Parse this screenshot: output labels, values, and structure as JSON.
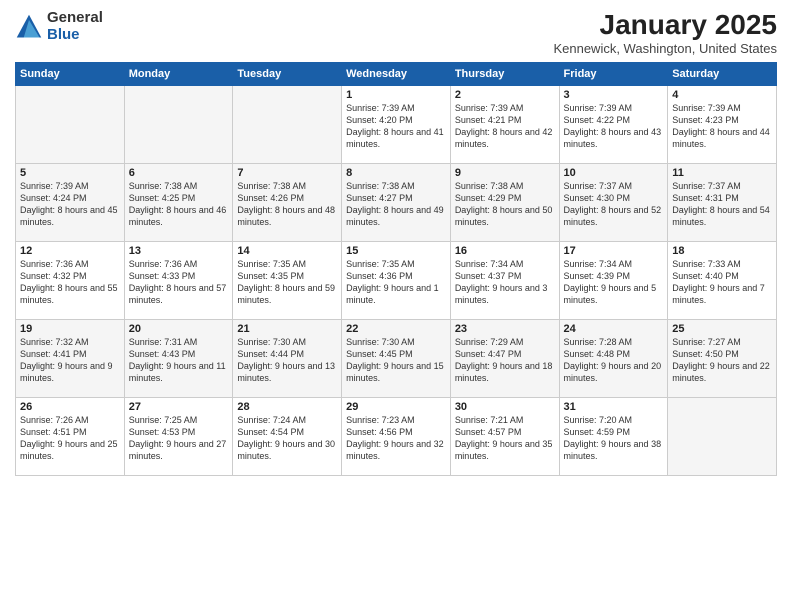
{
  "logo": {
    "general": "General",
    "blue": "Blue"
  },
  "title": "January 2025",
  "subtitle": "Kennewick, Washington, United States",
  "days_of_week": [
    "Sunday",
    "Monday",
    "Tuesday",
    "Wednesday",
    "Thursday",
    "Friday",
    "Saturday"
  ],
  "weeks": [
    [
      {
        "day": "",
        "info": "",
        "empty": true
      },
      {
        "day": "",
        "info": "",
        "empty": true
      },
      {
        "day": "",
        "info": "",
        "empty": true
      },
      {
        "day": "1",
        "info": "Sunrise: 7:39 AM\nSunset: 4:20 PM\nDaylight: 8 hours and 41 minutes.",
        "shade": false
      },
      {
        "day": "2",
        "info": "Sunrise: 7:39 AM\nSunset: 4:21 PM\nDaylight: 8 hours and 42 minutes.",
        "shade": false
      },
      {
        "day": "3",
        "info": "Sunrise: 7:39 AM\nSunset: 4:22 PM\nDaylight: 8 hours and 43 minutes.",
        "shade": false
      },
      {
        "day": "4",
        "info": "Sunrise: 7:39 AM\nSunset: 4:23 PM\nDaylight: 8 hours and 44 minutes.",
        "shade": false
      }
    ],
    [
      {
        "day": "5",
        "info": "Sunrise: 7:39 AM\nSunset: 4:24 PM\nDaylight: 8 hours and 45 minutes.",
        "shade": true
      },
      {
        "day": "6",
        "info": "Sunrise: 7:38 AM\nSunset: 4:25 PM\nDaylight: 8 hours and 46 minutes.",
        "shade": true
      },
      {
        "day": "7",
        "info": "Sunrise: 7:38 AM\nSunset: 4:26 PM\nDaylight: 8 hours and 48 minutes.",
        "shade": true
      },
      {
        "day": "8",
        "info": "Sunrise: 7:38 AM\nSunset: 4:27 PM\nDaylight: 8 hours and 49 minutes.",
        "shade": true
      },
      {
        "day": "9",
        "info": "Sunrise: 7:38 AM\nSunset: 4:29 PM\nDaylight: 8 hours and 50 minutes.",
        "shade": true
      },
      {
        "day": "10",
        "info": "Sunrise: 7:37 AM\nSunset: 4:30 PM\nDaylight: 8 hours and 52 minutes.",
        "shade": true
      },
      {
        "day": "11",
        "info": "Sunrise: 7:37 AM\nSunset: 4:31 PM\nDaylight: 8 hours and 54 minutes.",
        "shade": true
      }
    ],
    [
      {
        "day": "12",
        "info": "Sunrise: 7:36 AM\nSunset: 4:32 PM\nDaylight: 8 hours and 55 minutes.",
        "shade": false
      },
      {
        "day": "13",
        "info": "Sunrise: 7:36 AM\nSunset: 4:33 PM\nDaylight: 8 hours and 57 minutes.",
        "shade": false
      },
      {
        "day": "14",
        "info": "Sunrise: 7:35 AM\nSunset: 4:35 PM\nDaylight: 8 hours and 59 minutes.",
        "shade": false
      },
      {
        "day": "15",
        "info": "Sunrise: 7:35 AM\nSunset: 4:36 PM\nDaylight: 9 hours and 1 minute.",
        "shade": false
      },
      {
        "day": "16",
        "info": "Sunrise: 7:34 AM\nSunset: 4:37 PM\nDaylight: 9 hours and 3 minutes.",
        "shade": false
      },
      {
        "day": "17",
        "info": "Sunrise: 7:34 AM\nSunset: 4:39 PM\nDaylight: 9 hours and 5 minutes.",
        "shade": false
      },
      {
        "day": "18",
        "info": "Sunrise: 7:33 AM\nSunset: 4:40 PM\nDaylight: 9 hours and 7 minutes.",
        "shade": false
      }
    ],
    [
      {
        "day": "19",
        "info": "Sunrise: 7:32 AM\nSunset: 4:41 PM\nDaylight: 9 hours and 9 minutes.",
        "shade": true
      },
      {
        "day": "20",
        "info": "Sunrise: 7:31 AM\nSunset: 4:43 PM\nDaylight: 9 hours and 11 minutes.",
        "shade": true
      },
      {
        "day": "21",
        "info": "Sunrise: 7:30 AM\nSunset: 4:44 PM\nDaylight: 9 hours and 13 minutes.",
        "shade": true
      },
      {
        "day": "22",
        "info": "Sunrise: 7:30 AM\nSunset: 4:45 PM\nDaylight: 9 hours and 15 minutes.",
        "shade": true
      },
      {
        "day": "23",
        "info": "Sunrise: 7:29 AM\nSunset: 4:47 PM\nDaylight: 9 hours and 18 minutes.",
        "shade": true
      },
      {
        "day": "24",
        "info": "Sunrise: 7:28 AM\nSunset: 4:48 PM\nDaylight: 9 hours and 20 minutes.",
        "shade": true
      },
      {
        "day": "25",
        "info": "Sunrise: 7:27 AM\nSunset: 4:50 PM\nDaylight: 9 hours and 22 minutes.",
        "shade": true
      }
    ],
    [
      {
        "day": "26",
        "info": "Sunrise: 7:26 AM\nSunset: 4:51 PM\nDaylight: 9 hours and 25 minutes.",
        "shade": false
      },
      {
        "day": "27",
        "info": "Sunrise: 7:25 AM\nSunset: 4:53 PM\nDaylight: 9 hours and 27 minutes.",
        "shade": false
      },
      {
        "day": "28",
        "info": "Sunrise: 7:24 AM\nSunset: 4:54 PM\nDaylight: 9 hours and 30 minutes.",
        "shade": false
      },
      {
        "day": "29",
        "info": "Sunrise: 7:23 AM\nSunset: 4:56 PM\nDaylight: 9 hours and 32 minutes.",
        "shade": false
      },
      {
        "day": "30",
        "info": "Sunrise: 7:21 AM\nSunset: 4:57 PM\nDaylight: 9 hours and 35 minutes.",
        "shade": false
      },
      {
        "day": "31",
        "info": "Sunrise: 7:20 AM\nSunset: 4:59 PM\nDaylight: 9 hours and 38 minutes.",
        "shade": false
      },
      {
        "day": "",
        "info": "",
        "empty": true
      }
    ]
  ]
}
